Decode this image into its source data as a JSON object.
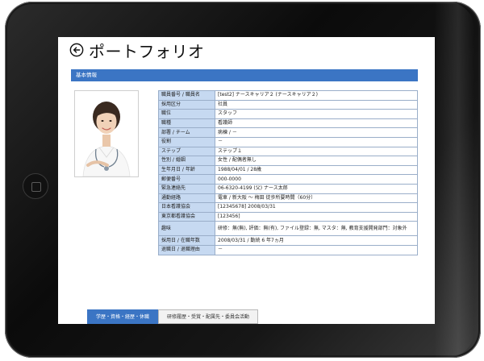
{
  "page": {
    "title": "ポートフォリオ"
  },
  "section": {
    "basic_info": "基本情報"
  },
  "profile_rows": [
    {
      "label": "職員番号 / 職員名",
      "value": "[test2] ナースキャリア２ (ナースキャリア２)"
    },
    {
      "label": "採用区分",
      "value": "社員"
    },
    {
      "label": "職位",
      "value": "スタッフ"
    },
    {
      "label": "職種",
      "value": "看護師"
    },
    {
      "label": "部署 / チーム",
      "value": "病棟 / －"
    },
    {
      "label": "役割",
      "value": "－"
    },
    {
      "label": "ステップ",
      "value": "ステップ１"
    },
    {
      "label": "性別 / 婚姻",
      "value": "女性 / 配偶者無し"
    },
    {
      "label": "生年月日 / 年齢",
      "value": "1988/04/01 / 28歳"
    },
    {
      "label": "郵便番号",
      "value": "000-0000"
    },
    {
      "label": "緊急連絡先",
      "value": "06-6320-4199 (父) ナース太郎"
    },
    {
      "label": "通勤経路",
      "value": "電車 / 新大阪 ～ 梅田 徒歩所要時間（60分）"
    },
    {
      "label": "日本看護協会",
      "value": "[12345678] 2008/03/31"
    },
    {
      "label": "東京都看護協会",
      "value": "[123456]"
    },
    {
      "label": "趣味",
      "value": "研修：無(無), 評価：無(有), ファイル登録：無, マスタ：無, 教育支援開発部門：対象外"
    },
    {
      "label": "採用日 / 在職年数",
      "value": "2008/03/31 / 勤続 6 年7ヵ月"
    },
    {
      "label": "退職日 / 退職理由",
      "value": "－"
    }
  ],
  "tabs": [
    {
      "label": "学歴・資格・経歴・休職",
      "active": true
    },
    {
      "label": "研修履歴・受賞・配属先・委員会活動",
      "active": false
    }
  ],
  "colors": {
    "accent": "#3b75c4",
    "label_cell": "#c6d9f1",
    "table_border": "#9aaec9"
  },
  "icons": {
    "back": "back-arrow-circle-icon"
  }
}
